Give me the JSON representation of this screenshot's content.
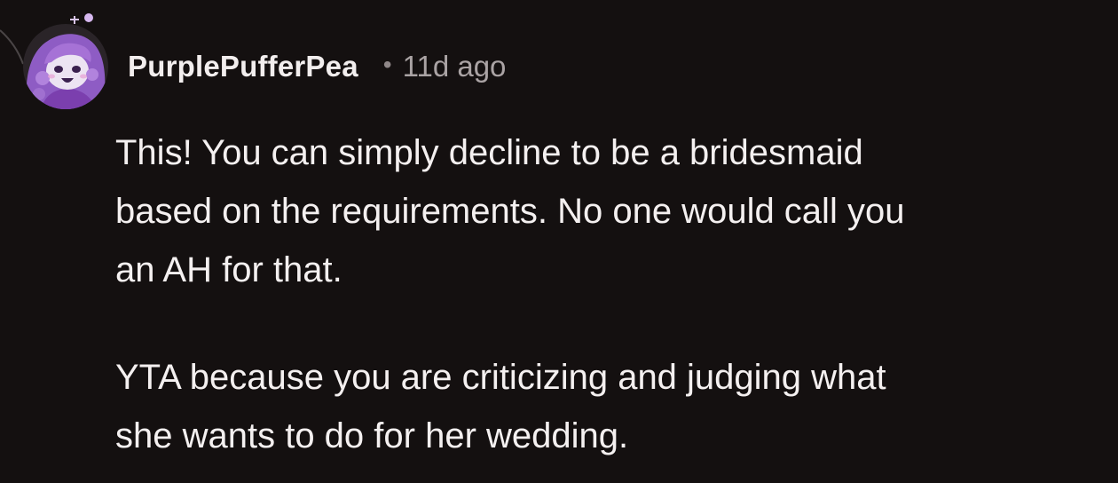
{
  "comment": {
    "author": "PurplePufferPea",
    "separator": "•",
    "timestamp": "11d ago",
    "paragraphs": [
      [
        "This! You can simply decline to be a bridesmaid",
        "based on the requirements. No one would call you",
        "an AH for that."
      ],
      [
        "YTA because you are criticizing and judging what",
        "she wants to do for her wedding."
      ]
    ]
  },
  "colors": {
    "background": "#141010",
    "text": "#f4f0f0",
    "muted": "#aaa3a4",
    "avatar_purple": "#9b6bcc"
  }
}
